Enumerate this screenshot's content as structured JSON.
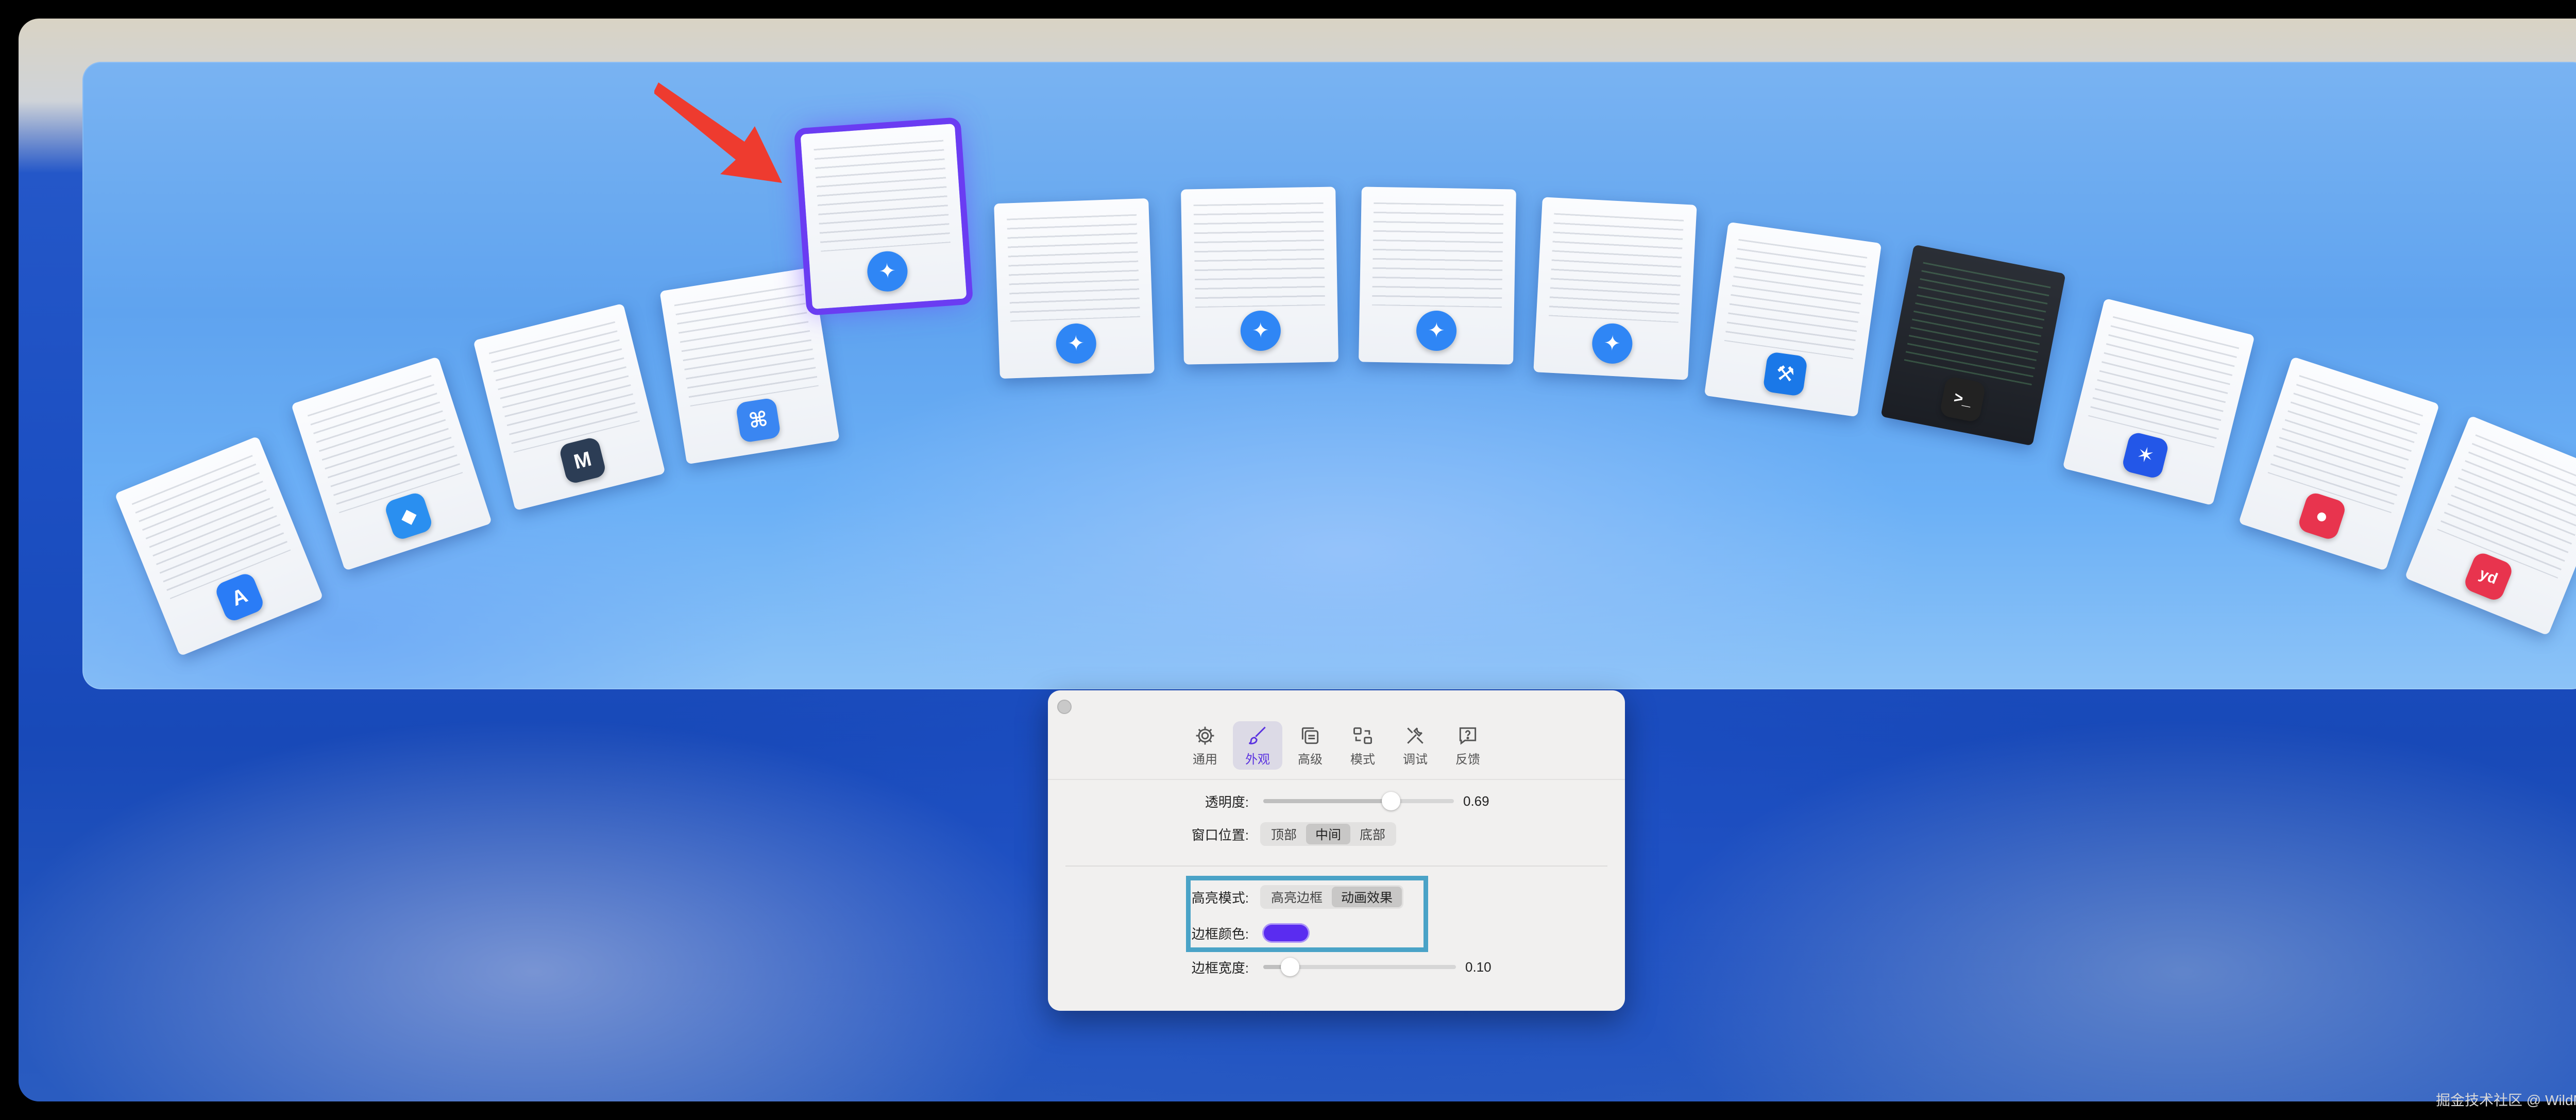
{
  "colors": {
    "selected_outline": "#6a3cf2",
    "highlight_box": "#4aa3c7",
    "border_color_swatch": "#5a2cf0",
    "arrow": "#ee3b2f"
  },
  "switcher": {
    "cards": [
      {
        "name": "app-store",
        "icon": "app-store-icon",
        "icon_char": "A",
        "icon_color": "#2a7cf6"
      },
      {
        "name": "vscode",
        "icon": "vscode-icon",
        "icon_char": "◆",
        "icon_color": "#2a8ff0"
      },
      {
        "name": "mweb",
        "icon": "mweb-icon",
        "icon_char": "M",
        "icon_color": "#2c3d55"
      },
      {
        "name": "finder-like",
        "icon": "app-icon",
        "icon_char": "⌘",
        "icon_color": "#3a86f2"
      },
      {
        "name": "safari-selected",
        "icon": "safari-icon",
        "icon_char": "✦",
        "icon_color": "#2f86f5"
      },
      {
        "name": "safari-2",
        "icon": "safari-icon",
        "icon_char": "✦",
        "icon_color": "#2f86f5"
      },
      {
        "name": "safari-3",
        "icon": "safari-icon",
        "icon_char": "✦",
        "icon_color": "#2f86f5"
      },
      {
        "name": "safari-4",
        "icon": "safari-icon",
        "icon_char": "✦",
        "icon_color": "#2f86f5"
      },
      {
        "name": "safari-5",
        "icon": "safari-icon",
        "icon_char": "✦",
        "icon_color": "#2f86f5"
      },
      {
        "name": "xcode",
        "icon": "xcode-icon",
        "icon_char": "⚒",
        "icon_color": "#1a78e8"
      },
      {
        "name": "terminal",
        "icon": "terminal-icon",
        "icon_char": ">_",
        "icon_color": "#222222"
      },
      {
        "name": "tencent-app",
        "icon": "app-icon",
        "icon_char": "✶",
        "icon_color": "#2357e8"
      },
      {
        "name": "calendar-app",
        "icon": "app-icon",
        "icon_char": "●",
        "icon_color": "#e8344e"
      },
      {
        "name": "youdao",
        "icon": "youdao-icon",
        "icon_char": "yd",
        "icon_color": "#e8344e"
      }
    ]
  },
  "settings": {
    "toolbar": [
      {
        "id": "general",
        "label": "通用",
        "icon": "gear-icon",
        "active": false
      },
      {
        "id": "appearance",
        "label": "外观",
        "icon": "brush-icon",
        "active": true
      },
      {
        "id": "advanced",
        "label": "高级",
        "icon": "copy-icon",
        "active": false
      },
      {
        "id": "mode",
        "label": "模式",
        "icon": "switch-icon",
        "active": false
      },
      {
        "id": "debug",
        "label": "调试",
        "icon": "tools-icon",
        "active": false
      },
      {
        "id": "feedback",
        "label": "反馈",
        "icon": "question-icon",
        "active": false
      }
    ],
    "opacity": {
      "label": "透明度:",
      "value": 0.69,
      "display": "0.69"
    },
    "window_position": {
      "label": "窗口位置:",
      "options": [
        "顶部",
        "中间",
        "底部"
      ],
      "selected": "中间"
    },
    "highlight_mode": {
      "label": "高亮模式:",
      "options": [
        "高亮边框",
        "动画效果"
      ],
      "selected": "动画效果"
    },
    "border_color": {
      "label": "边框颜色:"
    },
    "border_width": {
      "label": "边框宽度:",
      "value": 0.1,
      "display": "0.10"
    }
  },
  "watermark": "掘金技术社区 @ WildMildNull无为"
}
